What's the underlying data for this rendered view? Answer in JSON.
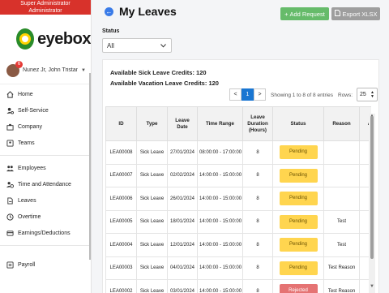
{
  "sidebar": {
    "role": "Super Administrator\nAdministrator",
    "role_line1": "Super Administrator",
    "role_line2": "Administrator",
    "logo_text": "eyebox",
    "user_name": "Nunez Jr, John Tristan A.",
    "notification_count": "6",
    "items": [
      {
        "label": "Home",
        "icon": "home-icon"
      },
      {
        "label": "Self-Service",
        "icon": "user-cog-icon"
      },
      {
        "label": "Company",
        "icon": "building-icon"
      },
      {
        "label": "Teams",
        "icon": "teams-icon"
      },
      {
        "label": "Employees",
        "icon": "employees-icon"
      },
      {
        "label": "Time and Attendance",
        "icon": "clock-user-icon"
      },
      {
        "label": "Leaves",
        "icon": "leaves-icon"
      },
      {
        "label": "Overtime",
        "icon": "overtime-icon"
      },
      {
        "label": "Earnings/Deductions",
        "icon": "earnings-icon"
      },
      {
        "label": "Payroll",
        "icon": "payroll-icon"
      }
    ]
  },
  "header": {
    "title": "My Leaves",
    "add_label": "Add Request",
    "export_label": "Export XLSX"
  },
  "filter": {
    "status_label": "Status",
    "status_value": "All"
  },
  "credits": {
    "sick": "Available Sick Leave Credits: 120",
    "vacation": "Available Vacation Leave Credits: 120"
  },
  "pagination": {
    "prev": "<",
    "current": "1",
    "next": ">",
    "showing": "Showing 1 to 8 of 8 entries",
    "rows_label": "Rows:",
    "rows_value": "25"
  },
  "table": {
    "headers": [
      "ID",
      "Type",
      "Leave Date",
      "Time Range",
      "Leave Duration (Hours)",
      "Status",
      "Reason",
      "A"
    ],
    "rows": [
      [
        "LEA00008",
        "Sick Leave",
        "27/01/2024",
        "08:00:00 - 17:00:00",
        "8",
        "Pending",
        ""
      ],
      [
        "LEA00007",
        "Sick Leave",
        "02/02/2024",
        "14:00:00 - 15:00:00",
        "8",
        "Pending",
        ""
      ],
      [
        "LEA00006",
        "Sick Leave",
        "26/01/2024",
        "14:00:00 - 15:00:00",
        "8",
        "Pending",
        ""
      ],
      [
        "LEA00005",
        "Sick Leave",
        "18/01/2024",
        "14:00:00 - 15:00:00",
        "8",
        "Pending",
        "Test"
      ],
      [
        "LEA00004",
        "Sick Leave",
        "12/01/2024",
        "14:00:00 - 15:00:00",
        "8",
        "Pending",
        "Test"
      ],
      [
        "LEA00003",
        "Sick Leave",
        "04/01/2024",
        "14:00:00 - 15:00:00",
        "8",
        "Pending",
        "Test Reason"
      ],
      [
        "LEA00002",
        "Sick Leave",
        "03/01/2024",
        "14:00:00 - 15:00:00",
        "8",
        "Rejected",
        "Test Reason"
      ]
    ]
  },
  "colors": {
    "accent": "#1976d2",
    "add_button": "#66bb6a",
    "export_button": "#9e9e9e",
    "pending": "#ffd54f",
    "rejected": "#e57373",
    "role_bar": "#d8322b"
  }
}
